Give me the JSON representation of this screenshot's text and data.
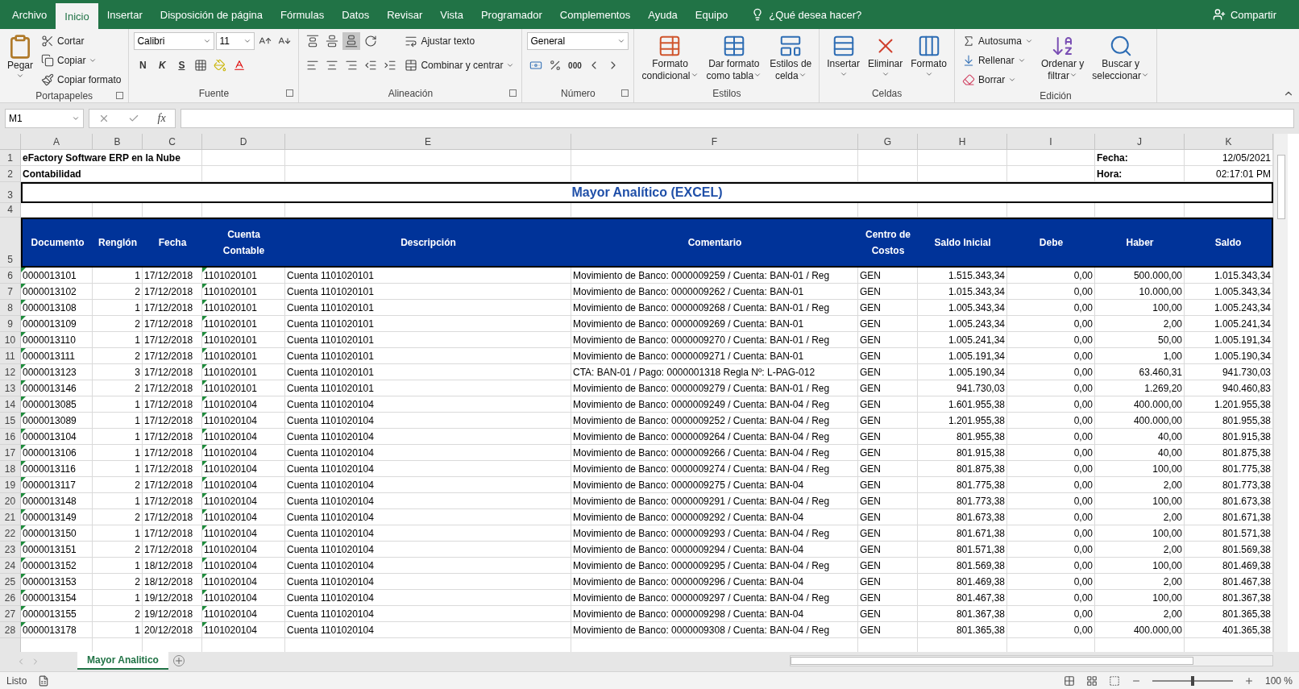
{
  "title_bar": {
    "tabs": [
      {
        "label": "Archivo",
        "selected": false
      },
      {
        "label": "Inicio",
        "selected": true
      },
      {
        "label": "Insertar",
        "selected": false
      },
      {
        "label": "Disposición de página",
        "selected": false
      },
      {
        "label": "Fórmulas",
        "selected": false
      },
      {
        "label": "Datos",
        "selected": false
      },
      {
        "label": "Revisar",
        "selected": false
      },
      {
        "label": "Vista",
        "selected": false
      },
      {
        "label": "Programador",
        "selected": false
      },
      {
        "label": "Complementos",
        "selected": false
      },
      {
        "label": "Ayuda",
        "selected": false
      },
      {
        "label": "Equipo",
        "selected": false
      }
    ],
    "tell_me": "¿Qué desea hacer?",
    "share": "Compartir"
  },
  "ribbon": {
    "clipboard": {
      "label": "Portapapeles",
      "paste": "Pegar",
      "items": [
        "Cortar",
        "Copiar",
        "Copiar formato"
      ]
    },
    "font": {
      "label": "Fuente",
      "font_name": "Calibri",
      "font_size": "11",
      "styles": [
        "N",
        "K",
        "S"
      ]
    },
    "alignment": {
      "label": "Alineación",
      "vertical": [
        {
          "selected": false
        },
        {
          "selected": false
        },
        {
          "selected": true
        }
      ],
      "wrap": "Ajustar texto",
      "merge": "Combinar y centrar"
    },
    "number": {
      "label": "Número",
      "format": "General",
      "thousands": "000"
    },
    "styles": {
      "label": "Estilos",
      "items": [
        [
          "Formato",
          "condicional"
        ],
        [
          "Dar formato",
          "como tabla"
        ],
        [
          "Estilos de",
          "celda"
        ]
      ]
    },
    "cells": {
      "label": "Celdas",
      "items": [
        "Insertar",
        "Eliminar",
        "Formato"
      ]
    },
    "editing": {
      "label": "Edición",
      "small": [
        "Autosuma",
        "Rellenar",
        "Borrar"
      ],
      "large": [
        [
          "Ordenar y",
          "filtrar"
        ],
        [
          "Buscar y",
          "seleccionar"
        ]
      ]
    }
  },
  "formula_bar": {
    "name_box": "M1",
    "function_label": "fx"
  },
  "sheet": {
    "columns": [
      "A",
      "B",
      "C",
      "D",
      "E",
      "F",
      "G",
      "H",
      "I",
      "J",
      "K"
    ],
    "info_rows": [
      {
        "number": "1",
        "left": "eFactory Software ERP en la Nube",
        "label": "Fecha:",
        "value": "12/05/2021"
      },
      {
        "number": "2",
        "left": "Contabilidad",
        "label": "Hora:",
        "value": "02:17:01 PM"
      }
    ],
    "title_row": {
      "number": "3",
      "text": "Mayor Analítico (EXCEL)"
    },
    "blank_row": {
      "number": "4"
    },
    "header_row": {
      "number": "5",
      "labels": [
        "Documento",
        "Renglón",
        "Fecha",
        "Cuenta Contable",
        "Descripción",
        "Comentario",
        "Centro de Costos",
        "Saldo Inicial",
        "Debe",
        "Haber",
        "Saldo"
      ]
    },
    "number_as_text_marks": true,
    "rows": [
      {
        "number": "6",
        "cells": [
          "0000013101",
          "1",
          "17/12/2018",
          "1101020101",
          "Cuenta 1101020101",
          "Movimiento de Banco: 0000009259 / Cuenta: BAN-01 / Reg",
          "GEN",
          "1.515.343,34",
          "0,00",
          "500.000,00",
          "1.015.343,34"
        ]
      },
      {
        "number": "7",
        "cells": [
          "0000013102",
          "2",
          "17/12/2018",
          "1101020101",
          "Cuenta 1101020101",
          "Movimiento de Banco: 0000009262 / Cuenta: BAN-01",
          "GEN",
          "1.015.343,34",
          "0,00",
          "10.000,00",
          "1.005.343,34"
        ]
      },
      {
        "number": "8",
        "cells": [
          "0000013108",
          "1",
          "17/12/2018",
          "1101020101",
          "Cuenta 1101020101",
          "Movimiento de Banco: 0000009268 / Cuenta: BAN-01 / Reg",
          "GEN",
          "1.005.343,34",
          "0,00",
          "100,00",
          "1.005.243,34"
        ]
      },
      {
        "number": "9",
        "cells": [
          "0000013109",
          "2",
          "17/12/2018",
          "1101020101",
          "Cuenta 1101020101",
          "Movimiento de Banco: 0000009269 / Cuenta: BAN-01",
          "GEN",
          "1.005.243,34",
          "0,00",
          "2,00",
          "1.005.241,34"
        ]
      },
      {
        "number": "10",
        "cells": [
          "0000013110",
          "1",
          "17/12/2018",
          "1101020101",
          "Cuenta 1101020101",
          "Movimiento de Banco: 0000009270 / Cuenta: BAN-01 / Reg",
          "GEN",
          "1.005.241,34",
          "0,00",
          "50,00",
          "1.005.191,34"
        ]
      },
      {
        "number": "11",
        "cells": [
          "0000013111",
          "2",
          "17/12/2018",
          "1101020101",
          "Cuenta 1101020101",
          "Movimiento de Banco: 0000009271 / Cuenta: BAN-01",
          "GEN",
          "1.005.191,34",
          "0,00",
          "1,00",
          "1.005.190,34"
        ]
      },
      {
        "number": "12",
        "cells": [
          "0000013123",
          "3",
          "17/12/2018",
          "1101020101",
          "Cuenta 1101020101",
          "CTA: BAN-01 / Pago: 0000001318 Regla Nº: L-PAG-012",
          "GEN",
          "1.005.190,34",
          "0,00",
          "63.460,31",
          "941.730,03"
        ]
      },
      {
        "number": "13",
        "cells": [
          "0000013146",
          "2",
          "17/12/2018",
          "1101020101",
          "Cuenta 1101020101",
          "Movimiento de Banco: 0000009279 / Cuenta: BAN-01 / Reg",
          "GEN",
          "941.730,03",
          "0,00",
          "1.269,20",
          "940.460,83"
        ]
      },
      {
        "number": "14",
        "cells": [
          "0000013085",
          "1",
          "17/12/2018",
          "1101020104",
          "Cuenta 1101020104",
          "Movimiento de Banco: 0000009249 / Cuenta: BAN-04 / Reg",
          "GEN",
          "1.601.955,38",
          "0,00",
          "400.000,00",
          "1.201.955,38"
        ]
      },
      {
        "number": "15",
        "cells": [
          "0000013089",
          "1",
          "17/12/2018",
          "1101020104",
          "Cuenta 1101020104",
          "Movimiento de Banco: 0000009252 / Cuenta: BAN-04 / Reg",
          "GEN",
          "1.201.955,38",
          "0,00",
          "400.000,00",
          "801.955,38"
        ]
      },
      {
        "number": "16",
        "cells": [
          "0000013104",
          "1",
          "17/12/2018",
          "1101020104",
          "Cuenta 1101020104",
          "Movimiento de Banco: 0000009264 / Cuenta: BAN-04 / Reg",
          "GEN",
          "801.955,38",
          "0,00",
          "40,00",
          "801.915,38"
        ]
      },
      {
        "number": "17",
        "cells": [
          "0000013106",
          "1",
          "17/12/2018",
          "1101020104",
          "Cuenta 1101020104",
          "Movimiento de Banco: 0000009266 / Cuenta: BAN-04 / Reg",
          "GEN",
          "801.915,38",
          "0,00",
          "40,00",
          "801.875,38"
        ]
      },
      {
        "number": "18",
        "cells": [
          "0000013116",
          "1",
          "17/12/2018",
          "1101020104",
          "Cuenta 1101020104",
          "Movimiento de Banco: 0000009274 / Cuenta: BAN-04 / Reg",
          "GEN",
          "801.875,38",
          "0,00",
          "100,00",
          "801.775,38"
        ]
      },
      {
        "number": "19",
        "cells": [
          "0000013117",
          "2",
          "17/12/2018",
          "1101020104",
          "Cuenta 1101020104",
          "Movimiento de Banco: 0000009275 / Cuenta: BAN-04",
          "GEN",
          "801.775,38",
          "0,00",
          "2,00",
          "801.773,38"
        ]
      },
      {
        "number": "20",
        "cells": [
          "0000013148",
          "1",
          "17/12/2018",
          "1101020104",
          "Cuenta 1101020104",
          "Movimiento de Banco: 0000009291 / Cuenta: BAN-04 / Reg",
          "GEN",
          "801.773,38",
          "0,00",
          "100,00",
          "801.673,38"
        ]
      },
      {
        "number": "21",
        "cells": [
          "0000013149",
          "2",
          "17/12/2018",
          "1101020104",
          "Cuenta 1101020104",
          "Movimiento de Banco: 0000009292 / Cuenta: BAN-04",
          "GEN",
          "801.673,38",
          "0,00",
          "2,00",
          "801.671,38"
        ]
      },
      {
        "number": "22",
        "cells": [
          "0000013150",
          "1",
          "17/12/2018",
          "1101020104",
          "Cuenta 1101020104",
          "Movimiento de Banco: 0000009293 / Cuenta: BAN-04 / Reg",
          "GEN",
          "801.671,38",
          "0,00",
          "100,00",
          "801.571,38"
        ]
      },
      {
        "number": "23",
        "cells": [
          "0000013151",
          "2",
          "17/12/2018",
          "1101020104",
          "Cuenta 1101020104",
          "Movimiento de Banco: 0000009294 / Cuenta: BAN-04",
          "GEN",
          "801.571,38",
          "0,00",
          "2,00",
          "801.569,38"
        ]
      },
      {
        "number": "24",
        "cells": [
          "0000013152",
          "1",
          "18/12/2018",
          "1101020104",
          "Cuenta 1101020104",
          "Movimiento de Banco: 0000009295 / Cuenta: BAN-04 / Reg",
          "GEN",
          "801.569,38",
          "0,00",
          "100,00",
          "801.469,38"
        ]
      },
      {
        "number": "25",
        "cells": [
          "0000013153",
          "2",
          "18/12/2018",
          "1101020104",
          "Cuenta 1101020104",
          "Movimiento de Banco: 0000009296 / Cuenta: BAN-04",
          "GEN",
          "801.469,38",
          "0,00",
          "2,00",
          "801.467,38"
        ]
      },
      {
        "number": "26",
        "cells": [
          "0000013154",
          "1",
          "19/12/2018",
          "1101020104",
          "Cuenta 1101020104",
          "Movimiento de Banco: 0000009297 / Cuenta: BAN-04 / Reg",
          "GEN",
          "801.467,38",
          "0,00",
          "100,00",
          "801.367,38"
        ]
      },
      {
        "number": "27",
        "cells": [
          "0000013155",
          "2",
          "19/12/2018",
          "1101020104",
          "Cuenta 1101020104",
          "Movimiento de Banco: 0000009298 / Cuenta: BAN-04",
          "GEN",
          "801.367,38",
          "0,00",
          "2,00",
          "801.365,38"
        ]
      },
      {
        "number": "28",
        "cells": [
          "0000013178",
          "1",
          "20/12/2018",
          "1101020104",
          "Cuenta 1101020104",
          "Movimiento de Banco: 0000009308 / Cuenta: BAN-04 / Reg",
          "GEN",
          "801.365,38",
          "0,00",
          "400.000,00",
          "401.365,38"
        ]
      }
    ]
  },
  "sheet_tabs": [
    {
      "label": "Mayor Analitico",
      "selected": true
    }
  ],
  "status_bar": {
    "status": "Listo",
    "zoom": "100 %",
    "zoom_slider": {
      "level": 0.5
    }
  }
}
